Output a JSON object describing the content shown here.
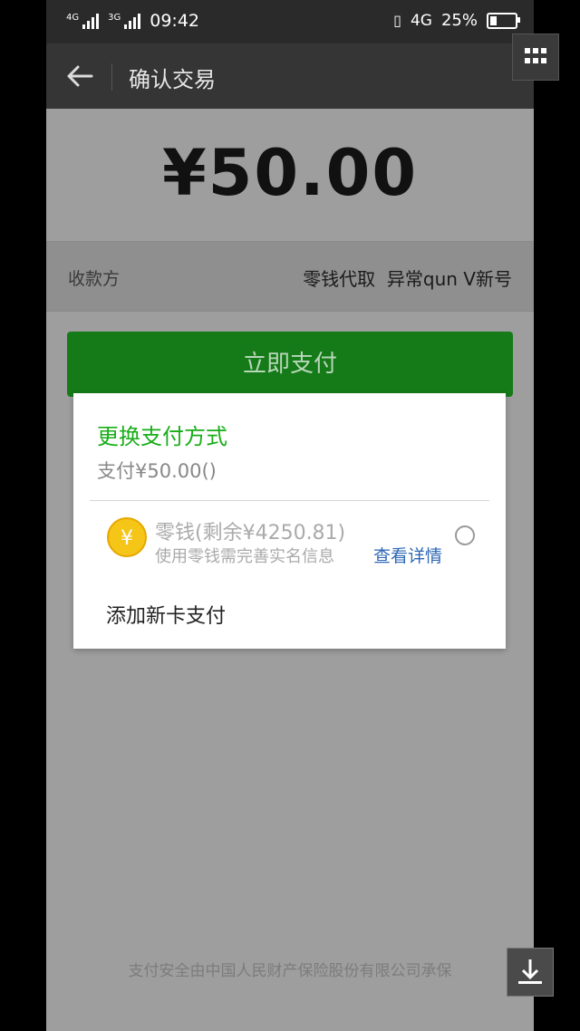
{
  "status_bar": {
    "signal1": "4G",
    "signal2": "3G",
    "time": "09:42",
    "network": "4G",
    "battery": "25%",
    "battery_level": 0.25
  },
  "navbar": {
    "title": "确认交易"
  },
  "payment": {
    "amount": "¥50.00",
    "payee_label": "收款方",
    "payee_value": "零钱代取  异常qun V新号",
    "pay_button": "立即支付"
  },
  "dialog": {
    "title": "更换支付方式",
    "subtitle": "支付¥50.00()",
    "option": {
      "coin_symbol": "¥",
      "main": "零钱(剩余¥4250.81)",
      "note": "使用零钱需完善实名信息",
      "link": "查看详情"
    },
    "add_card": "添加新卡支付"
  },
  "footer": {
    "note": "支付安全由中国人民财产保险股份有限公司承保"
  },
  "colors": {
    "accent_green": "#1aad19",
    "button_green": "#157a18",
    "link_blue": "#2d67b5"
  }
}
